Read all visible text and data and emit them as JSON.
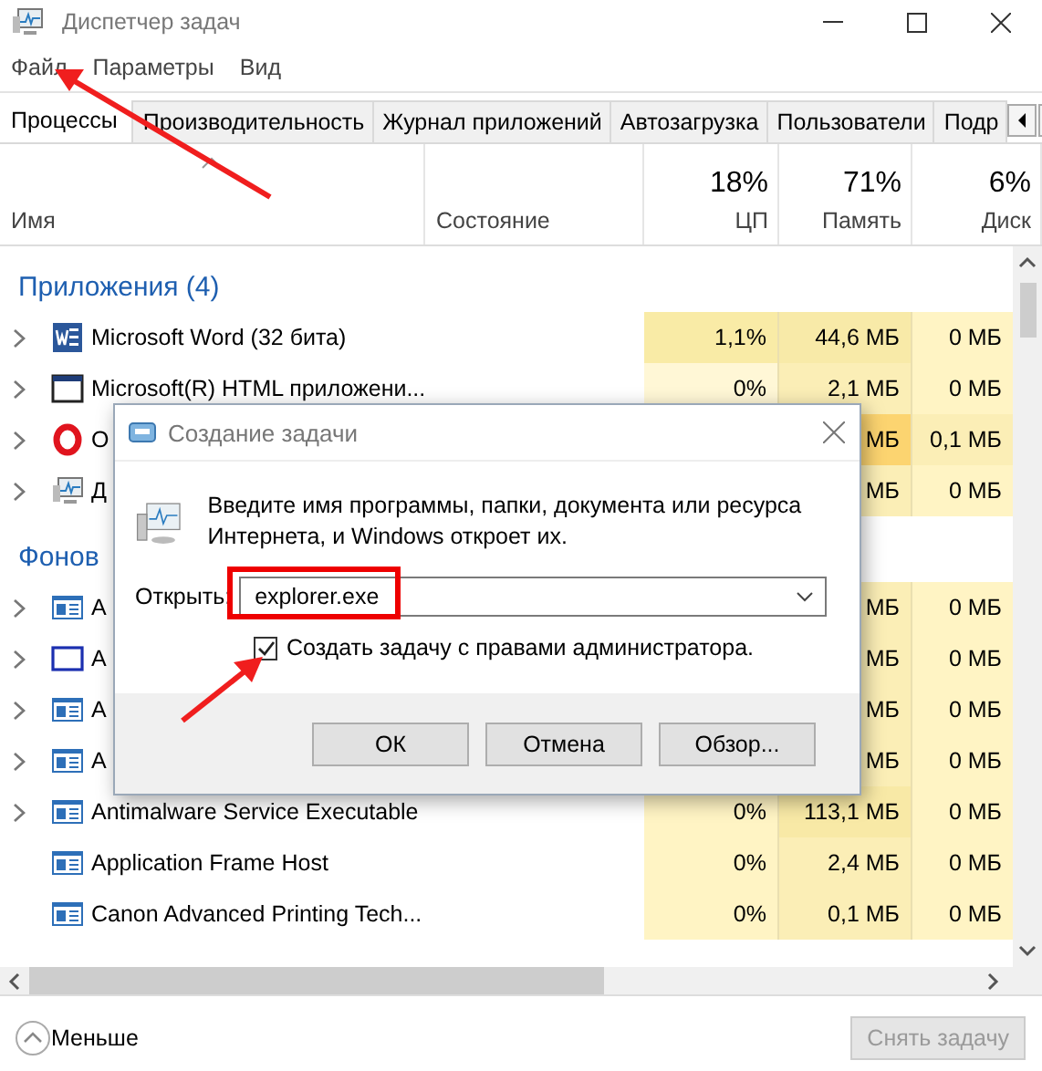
{
  "window": {
    "title": "Диспетчер задач"
  },
  "menu": [
    "Файл",
    "Параметры",
    "Вид"
  ],
  "tabs": [
    {
      "label": "Процессы",
      "selected": true
    },
    {
      "label": "Производительность",
      "selected": false
    },
    {
      "label": "Журнал приложений",
      "selected": false
    },
    {
      "label": "Автозагрузка",
      "selected": false
    },
    {
      "label": "Пользователи",
      "selected": false
    },
    {
      "label": "Подр",
      "selected": false
    }
  ],
  "columns": [
    {
      "label": "Имя",
      "sorted": true
    },
    {
      "label": "Состояние",
      "sorted": false
    },
    {
      "label": "ЦП",
      "usage": "18%",
      "sorted": false
    },
    {
      "label": "Память",
      "usage": "71%",
      "sorted": false
    },
    {
      "label": "Диск",
      "usage": "6%",
      "sorted": false
    }
  ],
  "groups": [
    {
      "title": "Приложения (4)",
      "rows": [
        {
          "name": "Microsoft Word (32 бита)",
          "kind": "word",
          "expandable": true,
          "cells": [
            {
              "text": "1,1%",
              "color": "#f9eba6"
            },
            {
              "text": "44,6 МБ",
              "color": "#f8eaa8"
            },
            {
              "text": "0 МБ",
              "color": "#fff4c4"
            }
          ]
        },
        {
          "name": "Microsoft(R) HTML приложени...",
          "kind": "window",
          "expandable": true,
          "cells": [
            {
              "text": "0%",
              "color": "#fff7d6"
            },
            {
              "text": "2,1 МБ",
              "color": "#fbeeb6"
            },
            {
              "text": "0 МБ",
              "color": "#fff4c4"
            }
          ]
        },
        {
          "name": "O",
          "kind": "ring",
          "expandable": true,
          "cells": [
            null,
            {
              "text": "МБ",
              "color": "#fcd470"
            },
            {
              "text": "0,1 МБ",
              "color": "#fbeeb6"
            }
          ]
        },
        {
          "name": "Д",
          "kind": "monitor",
          "expandable": true,
          "cells": [
            null,
            {
              "text": "МБ",
              "color": "#fbeeb6"
            },
            {
              "text": "0 МБ",
              "color": "#fff4c4"
            }
          ]
        }
      ]
    },
    {
      "title": "Фонов",
      "rows": [
        {
          "name": "A",
          "kind": "service",
          "expandable": true,
          "cells": [
            null,
            {
              "text": "МБ",
              "color": "#fbeeb6"
            },
            {
              "text": "0 МБ",
              "color": "#fff4c4"
            }
          ]
        },
        {
          "name": "A",
          "kind": "frame",
          "expandable": true,
          "cells": [
            null,
            {
              "text": "МБ",
              "color": "#fbeeb6"
            },
            {
              "text": "0 МБ",
              "color": "#fff4c4"
            }
          ]
        },
        {
          "name": "A",
          "kind": "service",
          "expandable": true,
          "cells": [
            null,
            {
              "text": "МБ",
              "color": "#fbeeb6"
            },
            {
              "text": "0 МБ",
              "color": "#fff4c4"
            }
          ]
        },
        {
          "name": "A",
          "kind": "service",
          "expandable": true,
          "cells": [
            null,
            {
              "text": "МБ",
              "color": "#fbeeb6"
            },
            {
              "text": "0 МБ",
              "color": "#fff4c4"
            }
          ]
        },
        {
          "name": "Antimalware Service Executable",
          "kind": "service",
          "expandable": true,
          "cells": [
            {
              "text": "0%",
              "color": "#fff4c4"
            },
            {
              "text": "113,1 МБ",
              "color": "#f8e9a6"
            },
            {
              "text": "0 МБ",
              "color": "#fff4c4"
            }
          ]
        },
        {
          "name": "Application Frame Host",
          "kind": "service",
          "expandable": false,
          "cells": [
            {
              "text": "0%",
              "color": "#fff4c4"
            },
            {
              "text": "2,4 МБ",
              "color": "#fbeeb6"
            },
            {
              "text": "0 МБ",
              "color": "#fff4c4"
            }
          ]
        },
        {
          "name": "Canon Advanced Printing Tech...",
          "kind": "service",
          "expandable": false,
          "cells": [
            {
              "text": "0%",
              "color": "#fff4c4"
            },
            {
              "text": "0,1 МБ",
              "color": "#fbeeb6"
            },
            {
              "text": "0 МБ",
              "color": "#fff4c4"
            }
          ]
        }
      ]
    }
  ],
  "footer": {
    "less": "Меньше",
    "end_task": {
      "label": "Снять задачу",
      "disabled": true
    }
  },
  "dialog": {
    "title": "Создание задачи",
    "prompt": "Введите имя программы, папки, документа или ресурса Интернета, и Windows откроет их.",
    "open_label": "Открыть:",
    "value": "explorer.exe",
    "admin": {
      "label": "Создать задачу с правами администратора.",
      "checked": true
    },
    "buttons": [
      "ОК",
      "Отмена",
      "Обзор..."
    ]
  }
}
